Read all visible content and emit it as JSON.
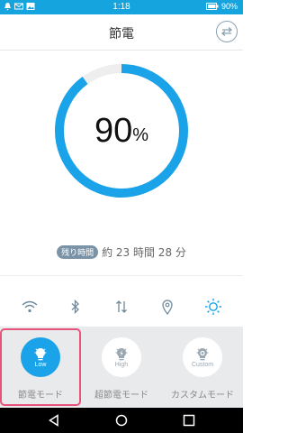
{
  "status_bar": {
    "time": "1:18",
    "battery_percent": "90%",
    "background_color": "#15a4dd"
  },
  "header": {
    "title": "節電",
    "menu_icon": "swap-arrows-icon"
  },
  "battery_gauge": {
    "value": "90",
    "unit": "%",
    "level_fraction": 0.9,
    "color": "#1aa3e8",
    "track_color": "#eeeeee"
  },
  "remaining_time": {
    "badge": "残り時間",
    "text": "約 23 時間 28 分"
  },
  "quick_toggles": [
    {
      "icon": "wifi-icon"
    },
    {
      "icon": "bluetooth-icon"
    },
    {
      "icon": "data-transfer-icon"
    },
    {
      "icon": "location-icon"
    },
    {
      "icon": "brightness-icon"
    }
  ],
  "modes": [
    {
      "label": "節電モード",
      "tier": "Low",
      "icon": "lightbulb-icon",
      "active": true,
      "color": "#1aa3e8"
    },
    {
      "label": "超節電モード",
      "tier": "High",
      "icon": "lightbulb-bolt-icon",
      "active": false
    },
    {
      "label": "カスタムモード",
      "tier": "Custom",
      "icon": "lightbulb-gear-icon",
      "active": false
    }
  ],
  "nav": {
    "back_icon": "back-triangle-icon",
    "home_icon": "home-circle-icon",
    "recents_icon": "recents-square-icon"
  }
}
